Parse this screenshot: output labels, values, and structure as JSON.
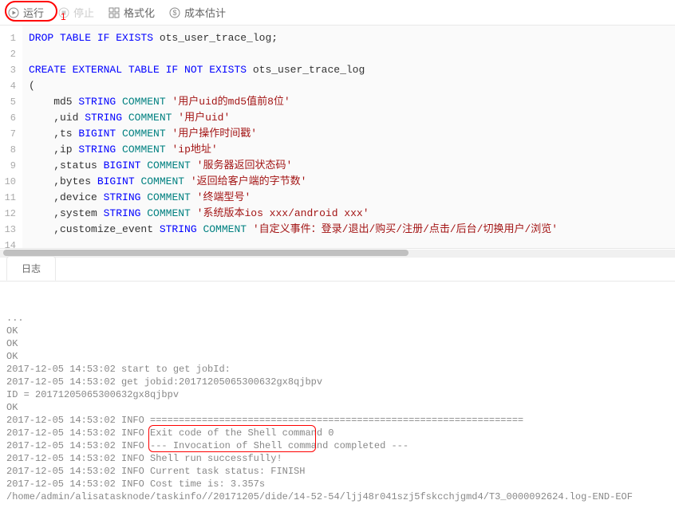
{
  "toolbar": {
    "run": "运行",
    "stop": "停止",
    "format": "格式化",
    "cost": "成本估计",
    "marker1": "1"
  },
  "editor": {
    "lines": [
      {
        "n": 1,
        "seg": [
          {
            "t": "DROP TABLE IF EXISTS",
            "c": "kw-blue"
          },
          {
            "t": " ots_user_trace_log;",
            "c": "ident"
          }
        ]
      },
      {
        "n": 2,
        "seg": []
      },
      {
        "n": 3,
        "seg": [
          {
            "t": "CREATE EXTERNAL TABLE IF NOT EXISTS",
            "c": "kw-blue"
          },
          {
            "t": " ots_user_trace_log",
            "c": "ident"
          }
        ]
      },
      {
        "n": 4,
        "seg": [
          {
            "t": "(",
            "c": "ident"
          }
        ]
      },
      {
        "n": 5,
        "seg": [
          {
            "t": "    md5 ",
            "c": "ident"
          },
          {
            "t": "STRING",
            "c": "kw-blue"
          },
          {
            "t": " ",
            "c": ""
          },
          {
            "t": "COMMENT",
            "c": "kw-teal"
          },
          {
            "t": " ",
            "c": ""
          },
          {
            "t": "'用户uid的md5值前8位'",
            "c": "str"
          }
        ]
      },
      {
        "n": 6,
        "seg": [
          {
            "t": "    ,uid ",
            "c": "ident"
          },
          {
            "t": "STRING",
            "c": "kw-blue"
          },
          {
            "t": " ",
            "c": ""
          },
          {
            "t": "COMMENT",
            "c": "kw-teal"
          },
          {
            "t": " ",
            "c": ""
          },
          {
            "t": "'用户uid'",
            "c": "str"
          }
        ]
      },
      {
        "n": 7,
        "seg": [
          {
            "t": "    ,ts ",
            "c": "ident"
          },
          {
            "t": "BIGINT",
            "c": "kw-blue"
          },
          {
            "t": " ",
            "c": ""
          },
          {
            "t": "COMMENT",
            "c": "kw-teal"
          },
          {
            "t": " ",
            "c": ""
          },
          {
            "t": "'用户操作时间戳'",
            "c": "str"
          }
        ]
      },
      {
        "n": 8,
        "seg": [
          {
            "t": "    ,ip ",
            "c": "ident"
          },
          {
            "t": "STRING",
            "c": "kw-blue"
          },
          {
            "t": " ",
            "c": ""
          },
          {
            "t": "COMMENT",
            "c": "kw-teal"
          },
          {
            "t": " ",
            "c": ""
          },
          {
            "t": "'ip地址'",
            "c": "str"
          }
        ]
      },
      {
        "n": 9,
        "seg": [
          {
            "t": "    ,status ",
            "c": "ident"
          },
          {
            "t": "BIGINT",
            "c": "kw-blue"
          },
          {
            "t": " ",
            "c": ""
          },
          {
            "t": "COMMENT",
            "c": "kw-teal"
          },
          {
            "t": " ",
            "c": ""
          },
          {
            "t": "'服务器返回状态码'",
            "c": "str"
          }
        ]
      },
      {
        "n": 10,
        "seg": [
          {
            "t": "    ,bytes ",
            "c": "ident"
          },
          {
            "t": "BIGINT",
            "c": "kw-blue"
          },
          {
            "t": " ",
            "c": ""
          },
          {
            "t": "COMMENT",
            "c": "kw-teal"
          },
          {
            "t": " ",
            "c": ""
          },
          {
            "t": "'返回给客户端的字节数'",
            "c": "str"
          }
        ]
      },
      {
        "n": 11,
        "seg": [
          {
            "t": "    ,device ",
            "c": "ident"
          },
          {
            "t": "STRING",
            "c": "kw-blue"
          },
          {
            "t": " ",
            "c": ""
          },
          {
            "t": "COMMENT",
            "c": "kw-teal"
          },
          {
            "t": " ",
            "c": ""
          },
          {
            "t": "'终端型号'",
            "c": "str"
          }
        ]
      },
      {
        "n": 12,
        "seg": [
          {
            "t": "    ,system ",
            "c": "ident"
          },
          {
            "t": "STRING",
            "c": "kw-blue"
          },
          {
            "t": " ",
            "c": ""
          },
          {
            "t": "COMMENT",
            "c": "kw-teal"
          },
          {
            "t": " ",
            "c": ""
          },
          {
            "t": "'系统版本ios xxx/android xxx'",
            "c": "str"
          }
        ]
      },
      {
        "n": 13,
        "seg": [
          {
            "t": "    ,customize_event ",
            "c": "ident"
          },
          {
            "t": "STRING",
            "c": "kw-blue"
          },
          {
            "t": " ",
            "c": ""
          },
          {
            "t": "COMMENT",
            "c": "kw-teal"
          },
          {
            "t": " ",
            "c": ""
          },
          {
            "t": "'自定义事件：登录/退出/购买/注册/点击/后台/切换用户/浏览'",
            "c": "str"
          }
        ]
      },
      {
        "n": 14,
        "seg": []
      }
    ]
  },
  "logtab": {
    "label": "日志"
  },
  "log": {
    "lines": [
      "...",
      "OK",
      "OK",
      "OK",
      "2017-12-05 14:53:02 start to get jobId:",
      "2017-12-05 14:53:02 get jobid:20171205065300632gx8qjbpv",
      "ID = 20171205065300632gx8qjbpv",
      "OK",
      "2017-12-05 14:53:02 INFO =================================================================",
      "2017-12-05 14:53:02 INFO Exit code of the Shell command 0",
      "2017-12-05 14:53:02 INFO --- Invocation of Shell command completed ---",
      "2017-12-05 14:53:02 INFO Shell run successfully!",
      "2017-12-05 14:53:02 INFO Current task status: FINISH",
      "2017-12-05 14:53:02 INFO Cost time is: 3.357s",
      "/home/admin/alisatasknode/taskinfo//20171205/dide/14-52-54/ljj48r041szj5fskcchjgmd4/T3_0000092624.log-END-EOF"
    ]
  }
}
